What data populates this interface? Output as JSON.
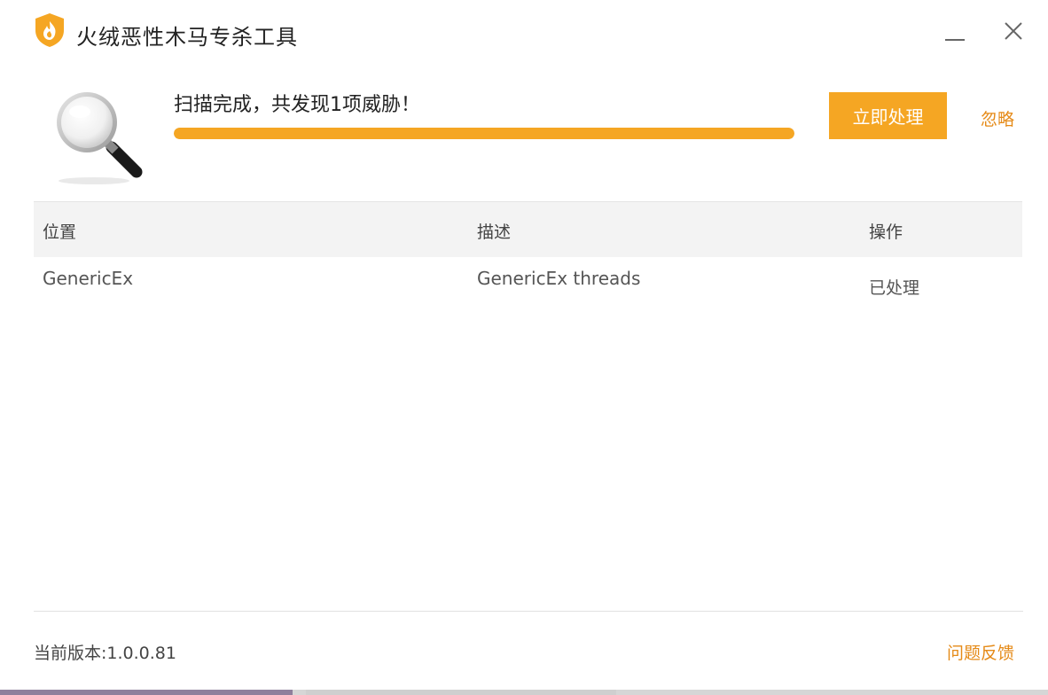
{
  "window": {
    "title": "火绒恶性木马专杀工具",
    "logo_icon": "huorong-shield-flame-icon",
    "minimize_icon": "minimize-icon",
    "close_icon": "close-icon"
  },
  "scan": {
    "status_text": "扫描完成，共发现1项威胁！",
    "progress_fraction": 1.0,
    "primary_action_label": "立即处理",
    "ignore_label": "忽略",
    "illustration_icon": "magnifier-icon"
  },
  "table": {
    "columns": [
      "位置",
      "描述",
      "操作"
    ],
    "rows": [
      {
        "location": "GenericEx",
        "description": "GenericEx threads",
        "action": "已处理"
      }
    ]
  },
  "footer": {
    "version_text": "当前版本:1.0.0.81",
    "feedback_label": "问题反馈"
  },
  "colors": {
    "accent": "#f5a623",
    "link": "#e58a17",
    "header_bg": "#f3f3f3"
  }
}
